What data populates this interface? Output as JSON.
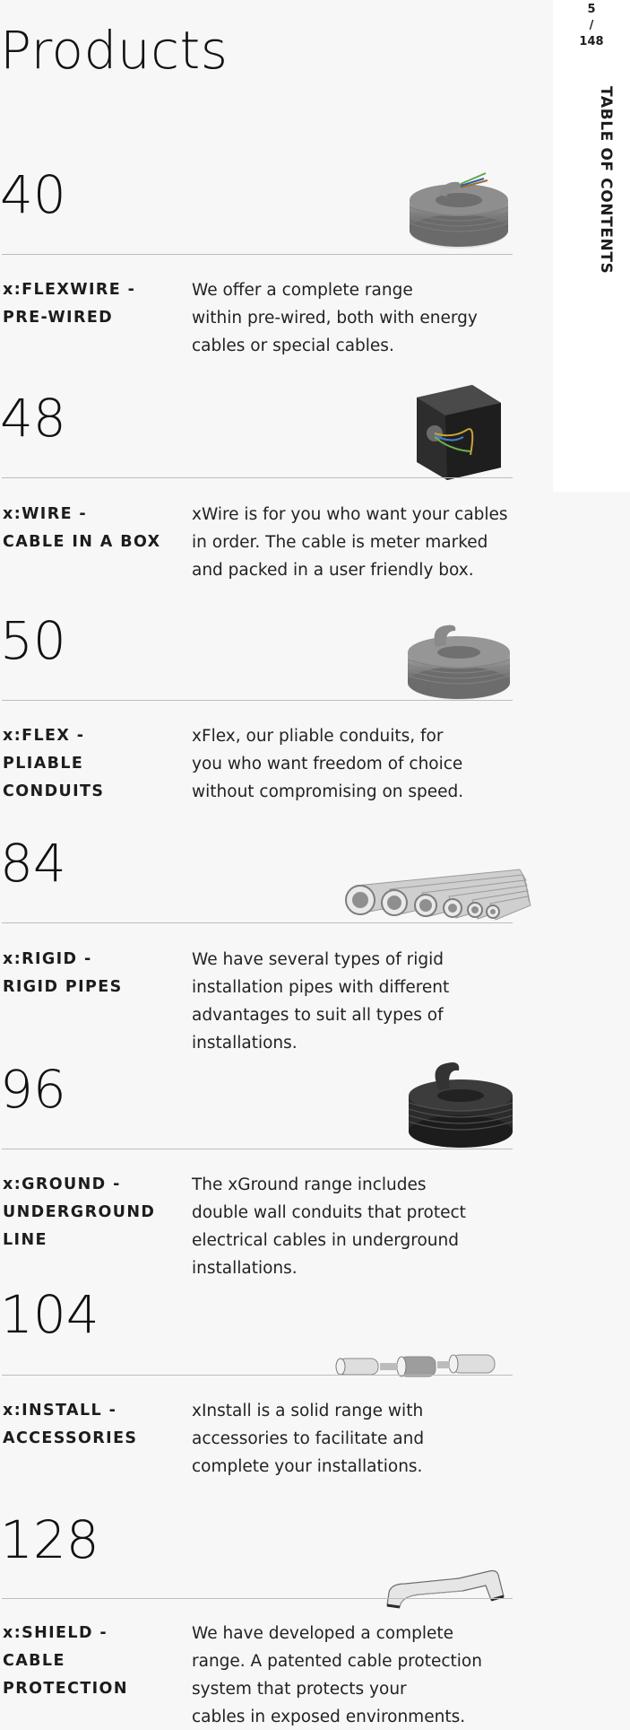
{
  "title": "Products",
  "page_counter": "5\n/\n148",
  "section_label": "TABLE OF CONTENTS",
  "entries": [
    {
      "page": "40",
      "title": "x:FLEXWIRE -\nPRE-WIRED",
      "description": "We offer a complete range\nwithin pre-wired, both with energy\ncables or special cables.",
      "image": "coil-with-wires"
    },
    {
      "page": "48",
      "title": "x:WIRE -\nCABLE IN A BOX",
      "description": "xWire is for you who want your cables\nin order. The cable is meter marked\nand packed in a user friendly box.",
      "image": "cable-box"
    },
    {
      "page": "50",
      "title": "x:FLEX -\nPLIABLE\nCONDUITS",
      "description": "xFlex, our pliable conduits, for\nyou who want freedom of choice\nwithout compromising on speed.",
      "image": "grey-conduit-coil"
    },
    {
      "page": "84",
      "title": "x:RIGID -\nRIGID PIPES",
      "description": "We have several types of rigid\ninstallation pipes with different\nadvantages to suit all types of\ninstallations.",
      "image": "rigid-pipes"
    },
    {
      "page": "96",
      "title": "x:GROUND -\nUNDERGROUND\nLINE",
      "description": "The xGround range includes\ndouble wall conduits that protect\nelectrical cables in underground\ninstallations.",
      "image": "black-conduit-coil"
    },
    {
      "page": "104",
      "title": "x:INSTALL -\nACCESSORIES",
      "description": "xInstall is a solid range with\naccessories to facilitate and\ncomplete your installations.",
      "image": "couplings"
    },
    {
      "page": "128",
      "title": "x:SHIELD -\nCABLE\nPROTECTION",
      "description": "We have developed a complete\nrange. A patented cable protection\nsystem that protects your\ncables in exposed environments.",
      "image": "cable-protector"
    }
  ]
}
